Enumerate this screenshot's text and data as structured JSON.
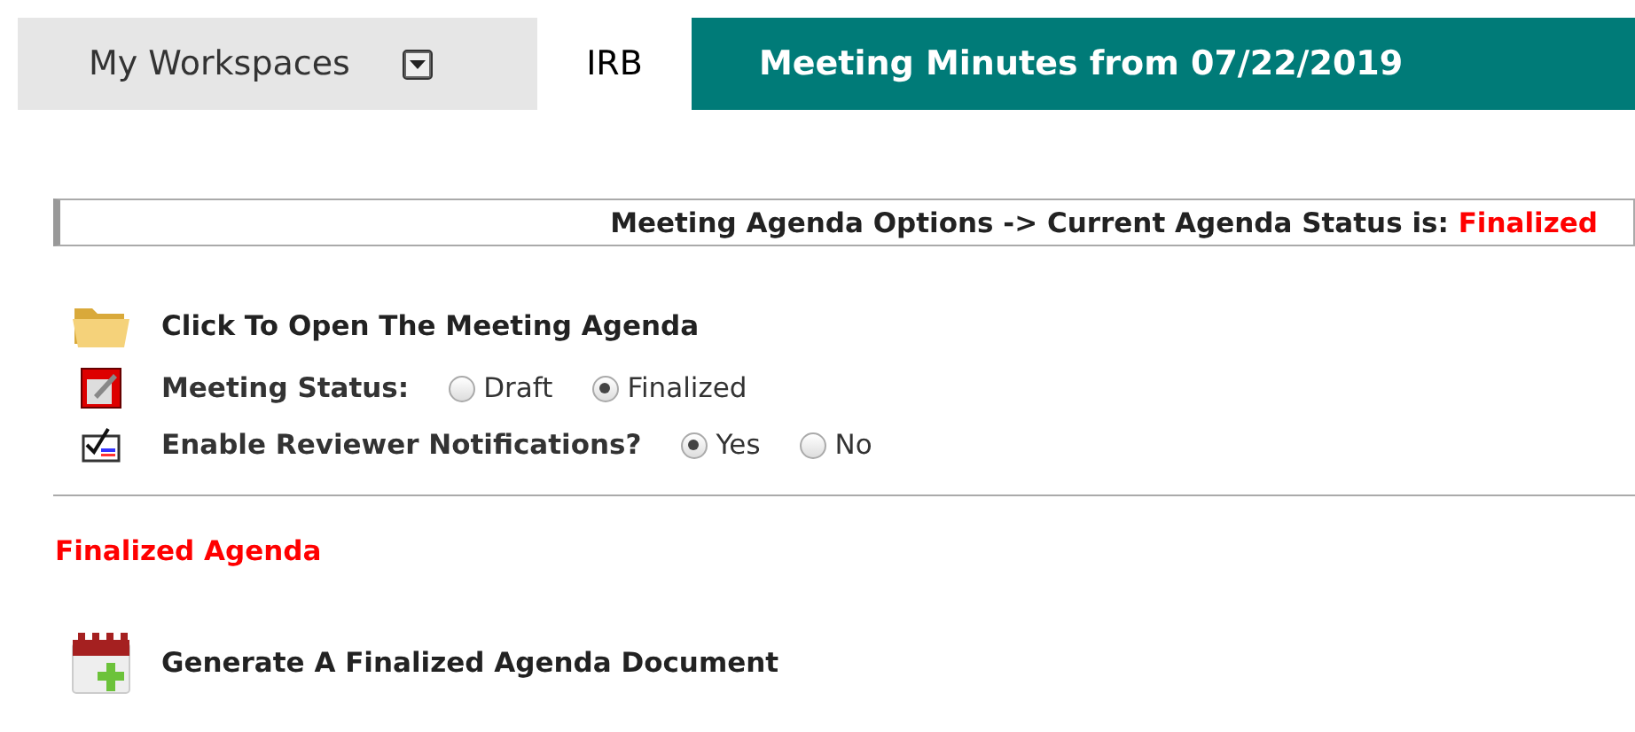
{
  "tabs": [
    {
      "label": "My Workspaces",
      "kind": "dropdown",
      "selected": false
    },
    {
      "label": "IRB",
      "kind": "plain",
      "selected": true
    }
  ],
  "page_title": "Meeting Minutes from 07/22/2019",
  "options_bar": {
    "label": "Meeting Agenda Options -> Current Agenda Status is:",
    "status": "Finalized"
  },
  "open_agenda_link": "Click To Open The Meeting Agenda",
  "meeting_status": {
    "label": "Meeting Status:",
    "options": [
      {
        "label": "Draft",
        "selected": false
      },
      {
        "label": "Finalized",
        "selected": true
      }
    ]
  },
  "notifications": {
    "label": "Enable Reviewer Notifications?",
    "options": [
      {
        "label": "Yes",
        "selected": true
      },
      {
        "label": "No",
        "selected": false
      }
    ]
  },
  "section_heading": "Finalized Agenda",
  "generate_link": "Generate A Finalized Agenda Document"
}
